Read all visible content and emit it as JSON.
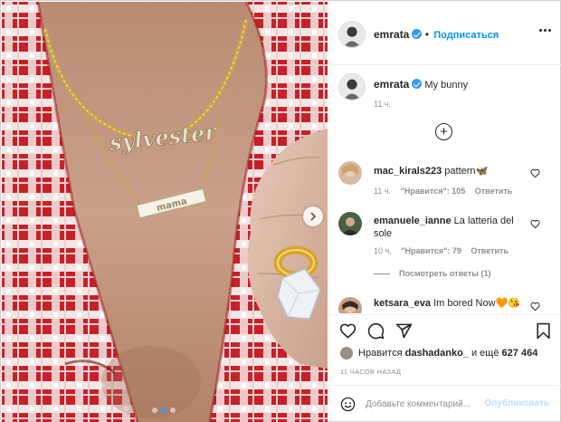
{
  "post": {
    "username": "emrata",
    "follow_label": "Подписаться",
    "caption_text": "My bunny",
    "caption_time": "11 ч.",
    "likes_prefix": "Нравится",
    "likes_user": "dashadanko_",
    "likes_and": "и ещё",
    "likes_count": "627 464",
    "time_ago": "11 ЧАСОВ НАЗАД",
    "photo_text_top": "sylvester",
    "photo_text_bar": "mama",
    "carousel": {
      "count": 3,
      "active": 1
    }
  },
  "comments": [
    {
      "user": "mac_kirals223",
      "text": "pattern🦋",
      "time": "11 ч.",
      "likes": "\"Нравится\": 105",
      "reply": "Ответить"
    },
    {
      "user": "emanuele_ianne",
      "text": "La latteria del",
      "text2": "sole",
      "time": "10 ч.",
      "likes": "\"Нравится\": 79",
      "reply": "Ответить",
      "view_replies": "Посмотреть ответы (1)"
    },
    {
      "user": "ketsara_eva",
      "text": "Im bored Now🧡😘"
    }
  ],
  "composer": {
    "placeholder": "Добавьте комментарий...",
    "publish_label": "Опубликовать"
  },
  "icons": {
    "header_more": "more-horizontal-icon",
    "verified": "verified-badge-icon",
    "load_more": "plus-circle-icon",
    "like": "heart-icon",
    "comment": "comment-bubble-icon",
    "share": "paper-plane-icon",
    "save": "bookmark-icon",
    "emoji": "smiley-icon",
    "next": "chevron-right-icon"
  },
  "colors": {
    "accent": "#0095f6",
    "verified": "#3897f0",
    "muted": "#8e8e8e",
    "publish_disabled": "#b2dffc",
    "jacket_red": "#c8202a"
  }
}
